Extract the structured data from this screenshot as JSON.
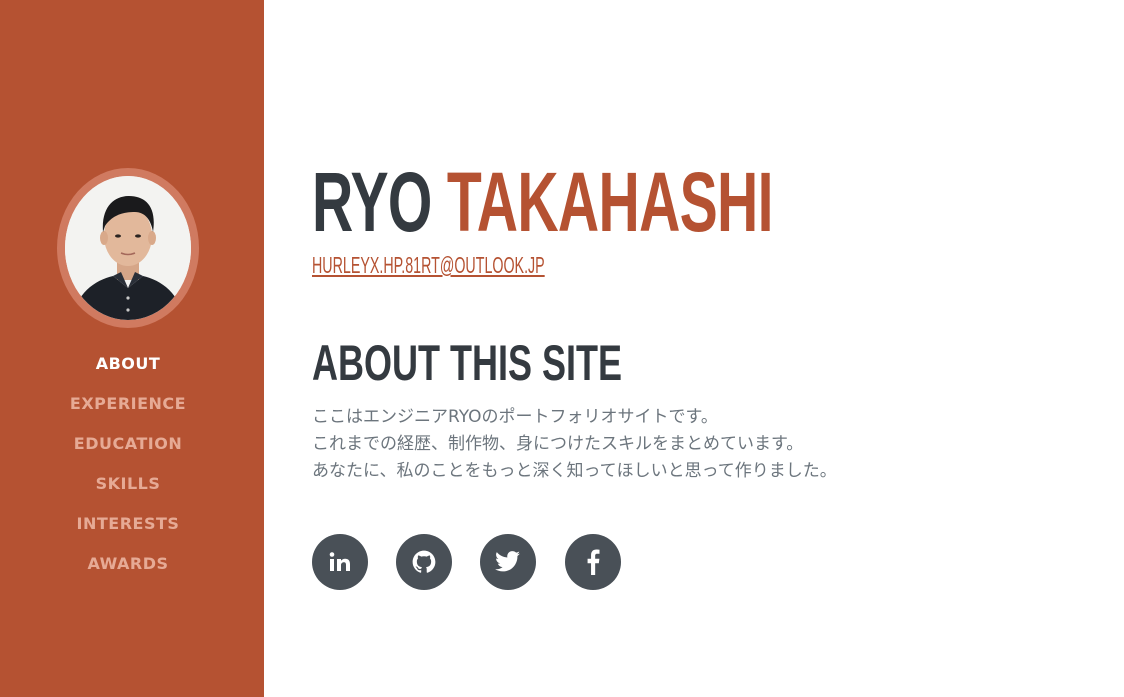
{
  "profile": {
    "first_name": "RYO",
    "last_name": "TAKAHASHI",
    "email": "HURLEYX.HP.81RT@OUTLOOK.JP"
  },
  "nav": {
    "items": [
      {
        "label": "ABOUT",
        "active": true
      },
      {
        "label": "EXPERIENCE",
        "active": false
      },
      {
        "label": "EDUCATION",
        "active": false
      },
      {
        "label": "SKILLS",
        "active": false
      },
      {
        "label": "INTERESTS",
        "active": false
      },
      {
        "label": "AWARDS",
        "active": false
      }
    ]
  },
  "about": {
    "title": "ABOUT THIS SITE",
    "lines": [
      "ここはエンジニアRYOのポートフォリオサイトです。",
      "これまでの経歴、制作物、身につけたスキルをまとめています。",
      "あなたに、私のことをもっと深く知ってほしいと思って作りました。"
    ]
  },
  "social": [
    {
      "icon": "linkedin-icon"
    },
    {
      "icon": "github-icon"
    },
    {
      "icon": "twitter-icon"
    },
    {
      "icon": "facebook-icon"
    }
  ],
  "colors": {
    "sidebar": "#b55232",
    "accent": "#b55232",
    "heading": "#343a40",
    "body_text": "#6c757d",
    "social_bg": "#495057"
  }
}
